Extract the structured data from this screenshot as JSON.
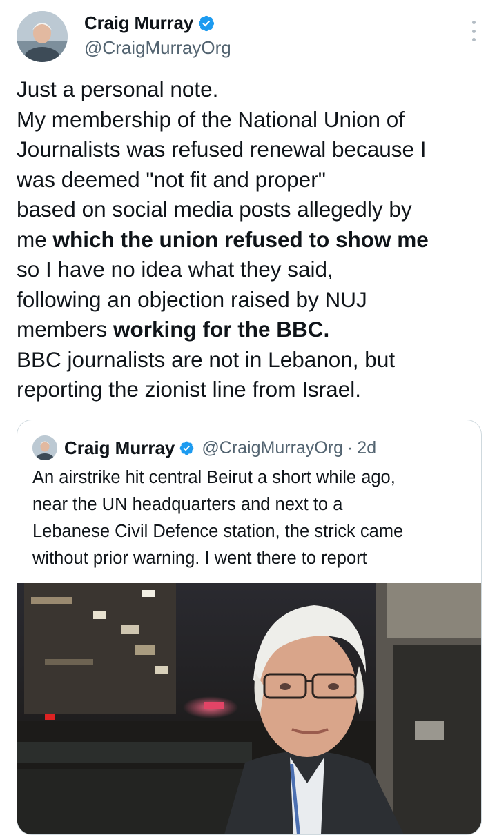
{
  "tweet": {
    "author_name": "Craig Murray",
    "author_handle": "@CraigMurrayOrg",
    "verified_icon": "verified-badge-icon",
    "more_icon": "more-options-icon",
    "lines": [
      "Just a personal note.",
      "My membership of the National Union of",
      "Journalists was refused renewal because I",
      "was deemed \"not fit and proper\"",
      "based on social media posts allegedly by",
      "me ",
      "which the union refused to show me",
      "so I have no idea what they said,",
      "following an objection raised by NUJ",
      "members ",
      "working for the BBC.",
      "BBC journalists are not in Lebanon, but",
      "reporting the zionist line from Israel."
    ]
  },
  "quoted_tweet": {
    "author_name": "Craig Murray",
    "author_handle": "@CraigMurrayOrg",
    "separator": "·",
    "time": "2d",
    "lines": [
      "An airstrike hit central Beirut a short while ago,",
      "near the UN headquarters and next to a",
      "Lebanese Civil Defence station, the strick came",
      "without prior warning. I went there to report"
    ]
  },
  "colors": {
    "text": "#0f1419",
    "secondary": "#536471",
    "verified": "#1d9bf0",
    "border": "#cfd9de"
  }
}
